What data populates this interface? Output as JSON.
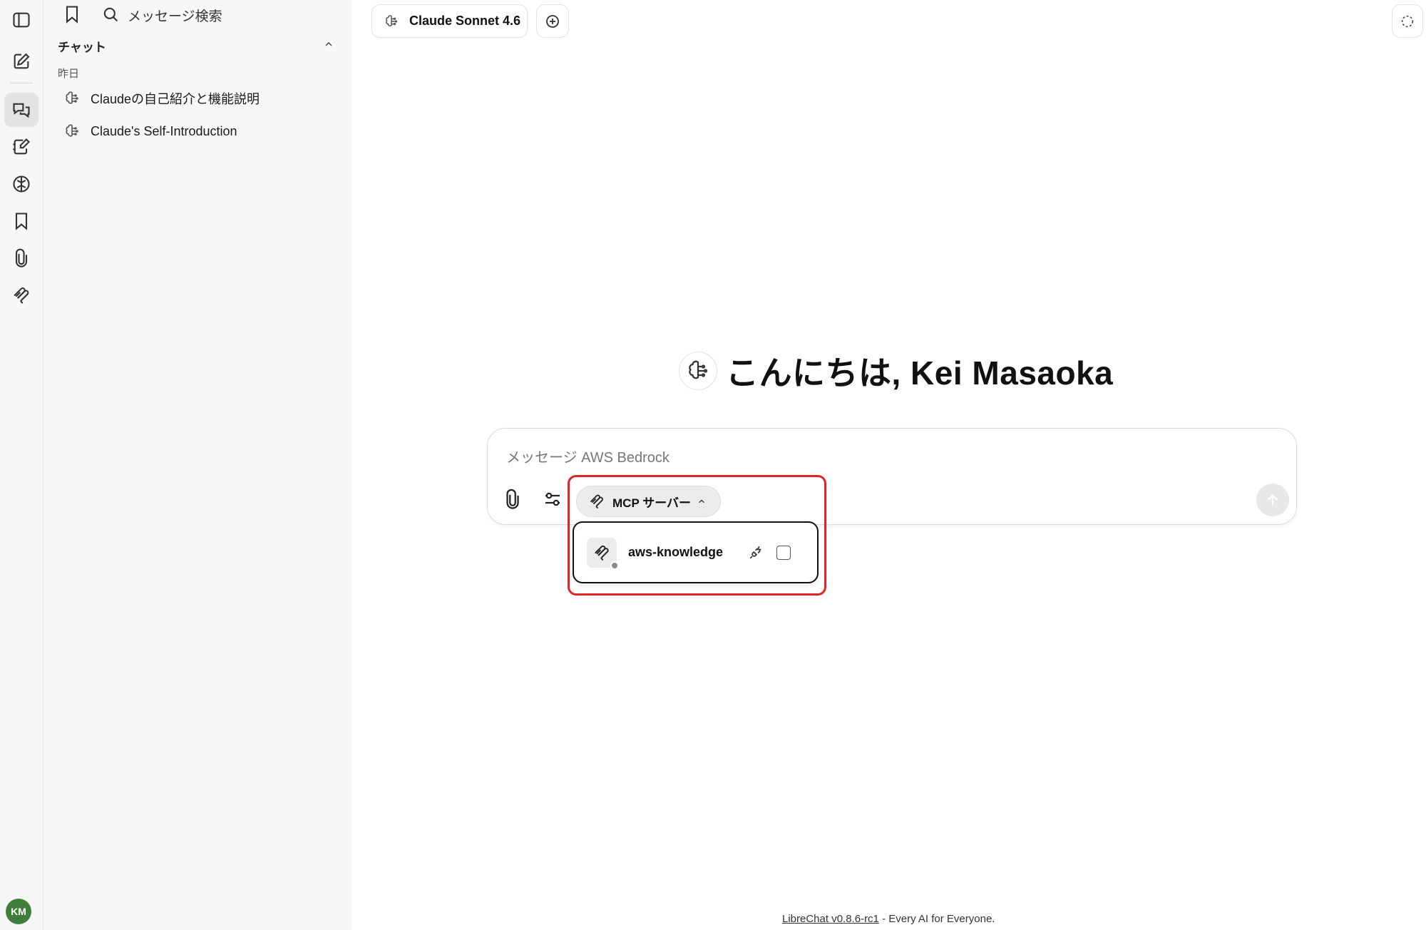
{
  "sidebar": {
    "search_placeholder": "メッセージ検索",
    "section_title": "チャット",
    "group_label": "昨日",
    "items": [
      {
        "label": "Claudeの自己紹介と機能説明"
      },
      {
        "label": "Claude's Self-Introduction"
      }
    ]
  },
  "user": {
    "initials": "KM"
  },
  "header": {
    "model_label": "Claude Sonnet 4.6"
  },
  "main": {
    "greeting": "こんにちは, Kei Masaoka",
    "composer": {
      "placeholder": "メッセージ AWS Bedrock",
      "mcp_label": "MCP サーバー"
    },
    "mcp_dropdown": {
      "items": [
        {
          "name": "aws-knowledge",
          "checked": false,
          "status_color": "#8a8a8a"
        }
      ]
    }
  },
  "footer": {
    "link_text": "LibreChat v0.8.6-rc1",
    "tagline": " - Every AI for Everyone."
  },
  "colors": {
    "highlight": "#e02424",
    "avatar_bg": "#3f7d3a",
    "sidebar_bg": "#f7f7f8"
  }
}
